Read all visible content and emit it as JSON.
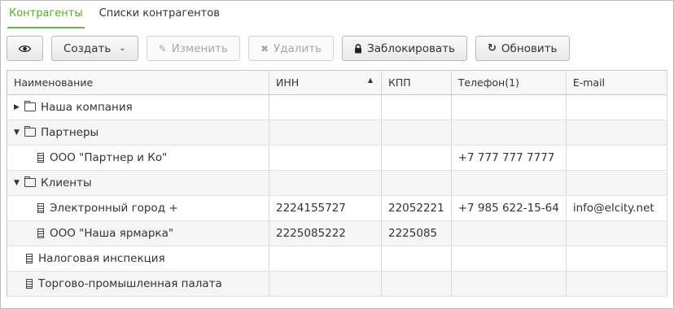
{
  "tabs": [
    {
      "label": "Контрагенты",
      "active": true
    },
    {
      "label": "Списки контрагентов",
      "active": false
    }
  ],
  "toolbar": {
    "view_icon": "eye-icon",
    "create_label": "Создать",
    "edit_label": "Изменить",
    "delete_label": "Удалить",
    "block_label": "Заблокировать",
    "refresh_label": "Обновить"
  },
  "columns": [
    "Наименование",
    "ИНН",
    "КПП",
    "Телефон(1)",
    "E-mail"
  ],
  "sort": {
    "column": "ИНН",
    "direction": "asc"
  },
  "rows": [
    {
      "name": "Наша компания",
      "type": "folder",
      "expanded": false,
      "level": 0,
      "inn": "",
      "kpp": "",
      "phone": "",
      "email": ""
    },
    {
      "name": "Партнеры",
      "type": "folder",
      "expanded": true,
      "level": 0,
      "inn": "",
      "kpp": "",
      "phone": "",
      "email": ""
    },
    {
      "name": "ООО \"Партнер и Ко\"",
      "type": "org",
      "level": 1,
      "inn": "",
      "kpp": "",
      "phone": "+7 777 777 7777",
      "email": ""
    },
    {
      "name": "Клиенты",
      "type": "folder",
      "expanded": true,
      "level": 0,
      "inn": "",
      "kpp": "",
      "phone": "",
      "email": ""
    },
    {
      "name": "Электронный город +",
      "type": "org",
      "level": 1,
      "inn": "2224155727",
      "kpp": "22052221",
      "phone": "+7 985 622-15-64",
      "email": "info@elcity.net"
    },
    {
      "name": "ООО \"Наша ярмарка\"",
      "type": "org",
      "level": 1,
      "inn": "2225085222",
      "kpp": "2225085",
      "phone": "",
      "email": ""
    },
    {
      "name": "Налоговая инспекция",
      "type": "org",
      "level": 0,
      "inn": "",
      "kpp": "",
      "phone": "",
      "email": ""
    },
    {
      "name": "Торгово-промышленная палата",
      "type": "org",
      "level": 0,
      "inn": "",
      "kpp": "",
      "phone": "",
      "email": ""
    }
  ]
}
